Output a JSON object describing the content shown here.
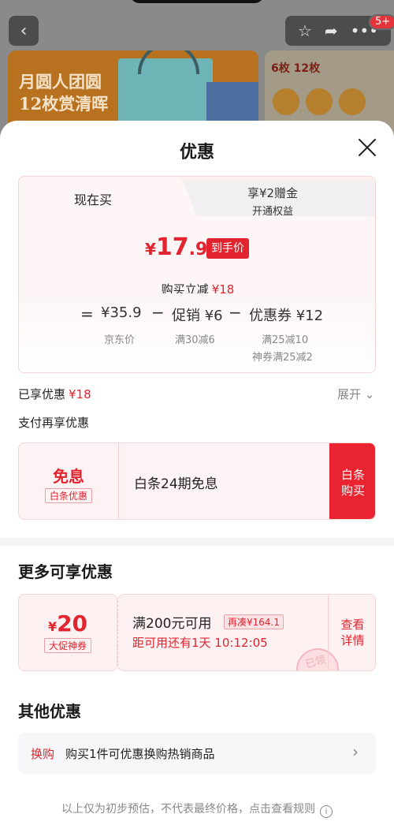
{
  "background": {
    "banner_left_text_1": "月圆人团圆",
    "banner_left_text_2": "12枚赏清晖",
    "banner_right_text": "6枚 12枚",
    "badge": "5+"
  },
  "sheet": {
    "title": "优惠",
    "tabs": {
      "active": "现在买",
      "inactive_line1": "享¥2赠金",
      "inactive_line2": "开通权益"
    },
    "final_price": {
      "yen": "¥",
      "int": "17",
      "dec": ".9",
      "tag": "到手价"
    },
    "save": {
      "label": "购买立减",
      "amount": "¥18"
    },
    "formula": {
      "eq": "=",
      "jd_price": "¥35.9",
      "jd_label": "京东价",
      "op1": "−",
      "promo": "促销 ¥6",
      "promo_label": "满30减6",
      "op2": "−",
      "coupon": "优惠券 ¥12",
      "coupon_label1": "满25减10",
      "coupon_label2": "神券满25减2"
    },
    "enjoyed": {
      "label": "已享优惠",
      "amount": "¥18",
      "expand": "展开"
    },
    "pay_more": "支付再享优惠",
    "baitiao": {
      "big": "免息",
      "tag": "白条优惠",
      "desc": "白条24期免息",
      "btn_line1": "白条",
      "btn_line2": "购买"
    },
    "more": {
      "title": "更多可享优惠",
      "coupon_yen": "¥",
      "coupon_value": "20",
      "coupon_tag": "大促神券",
      "condition": "满200元可用",
      "cou_tag": "再凑¥164.1",
      "countdown": "距可用还有1天 10:12:05",
      "detail_line1": "查看",
      "detail_line2": "详情",
      "stamp": "已领"
    },
    "other": {
      "title": "其他优惠",
      "swap_tag": "换购",
      "swap_text": "购买1件可优惠换购热销商品"
    },
    "footnote": "以上仅为初步预估，不代表最终价格，点击查看规则"
  }
}
